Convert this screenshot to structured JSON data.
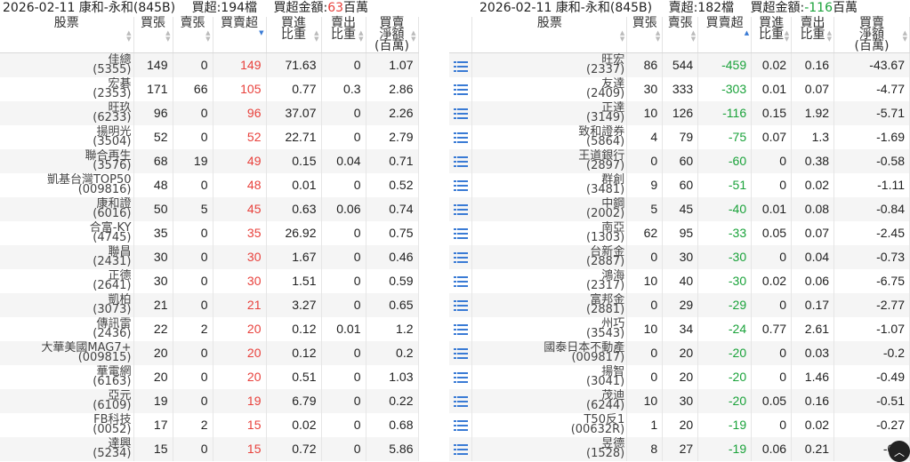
{
  "left": {
    "title": "2026-02-11 康和-永和(845B)",
    "summary_count": "買超:194檔",
    "summary_amount_label": "買超金額:",
    "summary_amount_value": "63",
    "summary_amount_unit": "百萬",
    "headers": [
      "股票",
      "買張",
      "賣張",
      "買賣超",
      "買進\n比重",
      "賣出\n比重",
      "買賣\n淨額\n(百萬)"
    ],
    "rows": [
      {
        "name": "佳總",
        "code": "(5355)",
        "buy": "149",
        "sell": "0",
        "net": "149",
        "buy_ratio": "71.63",
        "sell_ratio": "0",
        "amount": "1.07"
      },
      {
        "name": "宏碁",
        "code": "(2353)",
        "buy": "171",
        "sell": "66",
        "net": "105",
        "buy_ratio": "0.77",
        "sell_ratio": "0.3",
        "amount": "2.86"
      },
      {
        "name": "旺玖",
        "code": "(6233)",
        "buy": "96",
        "sell": "0",
        "net": "96",
        "buy_ratio": "37.07",
        "sell_ratio": "0",
        "amount": "2.26"
      },
      {
        "name": "揚明光",
        "code": "(3504)",
        "buy": "52",
        "sell": "0",
        "net": "52",
        "buy_ratio": "22.71",
        "sell_ratio": "0",
        "amount": "2.79"
      },
      {
        "name": "聯合再生",
        "code": "(3576)",
        "buy": "68",
        "sell": "19",
        "net": "49",
        "buy_ratio": "0.15",
        "sell_ratio": "0.04",
        "amount": "0.71"
      },
      {
        "name": "凱基台灣TOP50",
        "code": "(009816)",
        "buy": "48",
        "sell": "0",
        "net": "48",
        "buy_ratio": "0.01",
        "sell_ratio": "0",
        "amount": "0.52"
      },
      {
        "name": "康和證",
        "code": "(6016)",
        "buy": "50",
        "sell": "5",
        "net": "45",
        "buy_ratio": "0.63",
        "sell_ratio": "0.06",
        "amount": "0.74"
      },
      {
        "name": "合富-KY",
        "code": "(4745)",
        "buy": "35",
        "sell": "0",
        "net": "35",
        "buy_ratio": "26.92",
        "sell_ratio": "0",
        "amount": "0.75"
      },
      {
        "name": "聯昌",
        "code": "(2431)",
        "buy": "30",
        "sell": "0",
        "net": "30",
        "buy_ratio": "1.67",
        "sell_ratio": "0",
        "amount": "0.46"
      },
      {
        "name": "正德",
        "code": "(2641)",
        "buy": "30",
        "sell": "0",
        "net": "30",
        "buy_ratio": "1.51",
        "sell_ratio": "0",
        "amount": "0.59"
      },
      {
        "name": "凱柏",
        "code": "(3073)",
        "buy": "21",
        "sell": "0",
        "net": "21",
        "buy_ratio": "3.27",
        "sell_ratio": "0",
        "amount": "0.65"
      },
      {
        "name": "傳訊雷",
        "code": "(2436)",
        "buy": "22",
        "sell": "2",
        "net": "20",
        "buy_ratio": "0.12",
        "sell_ratio": "0.01",
        "amount": "1.2"
      },
      {
        "name": "大華美國MAG7+",
        "code": "(009815)",
        "buy": "20",
        "sell": "0",
        "net": "20",
        "buy_ratio": "0.12",
        "sell_ratio": "0",
        "amount": "0.2"
      },
      {
        "name": "華電網",
        "code": "(6163)",
        "buy": "20",
        "sell": "0",
        "net": "20",
        "buy_ratio": "0.51",
        "sell_ratio": "0",
        "amount": "1.03"
      },
      {
        "name": "亞元",
        "code": "(6109)",
        "buy": "19",
        "sell": "0",
        "net": "19",
        "buy_ratio": "6.79",
        "sell_ratio": "0",
        "amount": "0.22"
      },
      {
        "name": "FB科技",
        "code": "(0052)",
        "buy": "17",
        "sell": "2",
        "net": "15",
        "buy_ratio": "0.02",
        "sell_ratio": "0",
        "amount": "0.68"
      },
      {
        "name": "達興",
        "code": "(5234)",
        "buy": "15",
        "sell": "0",
        "net": "15",
        "buy_ratio": "0.72",
        "sell_ratio": "0",
        "amount": "5.86"
      }
    ]
  },
  "right": {
    "title": "2026-02-11 康和-永和(845B)",
    "summary_count": "賣超:182檔",
    "summary_amount_label": "買超金額:",
    "summary_amount_value": "-116",
    "summary_amount_unit": "百萬",
    "headers": [
      "",
      "股票",
      "買張",
      "賣張",
      "買賣超",
      "買進\n比重",
      "賣出\n比重",
      "買賣\n淨額\n(百萬)"
    ],
    "rows": [
      {
        "name": "旺宏",
        "code": "(2337)",
        "buy": "86",
        "sell": "544",
        "net": "-459",
        "buy_ratio": "0.02",
        "sell_ratio": "0.16",
        "amount": "-43.67"
      },
      {
        "name": "友達",
        "code": "(2409)",
        "buy": "30",
        "sell": "333",
        "net": "-303",
        "buy_ratio": "0.01",
        "sell_ratio": "0.07",
        "amount": "-4.77"
      },
      {
        "name": "正達",
        "code": "(3149)",
        "buy": "10",
        "sell": "126",
        "net": "-116",
        "buy_ratio": "0.15",
        "sell_ratio": "1.92",
        "amount": "-5.71"
      },
      {
        "name": "致和證券",
        "code": "(5864)",
        "buy": "4",
        "sell": "79",
        "net": "-75",
        "buy_ratio": "0.07",
        "sell_ratio": "1.3",
        "amount": "-1.69"
      },
      {
        "name": "王道銀行",
        "code": "(2897)",
        "buy": "0",
        "sell": "60",
        "net": "-60",
        "buy_ratio": "0",
        "sell_ratio": "0.38",
        "amount": "-0.58"
      },
      {
        "name": "群創",
        "code": "(3481)",
        "buy": "9",
        "sell": "60",
        "net": "-51",
        "buy_ratio": "0",
        "sell_ratio": "0.02",
        "amount": "-1.11"
      },
      {
        "name": "中鋼",
        "code": "(2002)",
        "buy": "5",
        "sell": "45",
        "net": "-40",
        "buy_ratio": "0.01",
        "sell_ratio": "0.08",
        "amount": "-0.84"
      },
      {
        "name": "南亞",
        "code": "(1303)",
        "buy": "62",
        "sell": "95",
        "net": "-33",
        "buy_ratio": "0.05",
        "sell_ratio": "0.07",
        "amount": "-2.45"
      },
      {
        "name": "台新金",
        "code": "(2887)",
        "buy": "0",
        "sell": "30",
        "net": "-30",
        "buy_ratio": "0",
        "sell_ratio": "0.04",
        "amount": "-0.73"
      },
      {
        "name": "鴻海",
        "code": "(2317)",
        "buy": "10",
        "sell": "40",
        "net": "-30",
        "buy_ratio": "0.02",
        "sell_ratio": "0.06",
        "amount": "-6.75"
      },
      {
        "name": "富邦金",
        "code": "(2881)",
        "buy": "0",
        "sell": "29",
        "net": "-29",
        "buy_ratio": "0",
        "sell_ratio": "0.17",
        "amount": "-2.77"
      },
      {
        "name": "州巧",
        "code": "(3543)",
        "buy": "10",
        "sell": "34",
        "net": "-24",
        "buy_ratio": "0.77",
        "sell_ratio": "2.61",
        "amount": "-1.07"
      },
      {
        "name": "國泰日本不動產",
        "code": "(009817)",
        "buy": "0",
        "sell": "20",
        "net": "-20",
        "buy_ratio": "0",
        "sell_ratio": "0.03",
        "amount": "-0.2"
      },
      {
        "name": "揚智",
        "code": "(3041)",
        "buy": "0",
        "sell": "20",
        "net": "-20",
        "buy_ratio": "0",
        "sell_ratio": "1.46",
        "amount": "-0.49"
      },
      {
        "name": "茂迪",
        "code": "(6244)",
        "buy": "10",
        "sell": "30",
        "net": "-20",
        "buy_ratio": "0.05",
        "sell_ratio": "0.16",
        "amount": "-0.51"
      },
      {
        "name": "T50反1",
        "code": "(00632R)",
        "buy": "1",
        "sell": "20",
        "net": "-19",
        "buy_ratio": "0",
        "sell_ratio": "0.02",
        "amount": "-0.27"
      },
      {
        "name": "昱德",
        "code": "(1528)",
        "buy": "8",
        "sell": "27",
        "net": "-19",
        "buy_ratio": "0.06",
        "sell_ratio": "0.21",
        "amount": "-0.4"
      }
    ]
  },
  "icons": {
    "row_menu": "list-icon",
    "scroll_top": "chevron-up-icon"
  },
  "colors": {
    "positive": "#e8413c",
    "negative": "#1aa23a",
    "sort_active": "#3a7bd5",
    "row_stripe": "#f5f5f5"
  }
}
